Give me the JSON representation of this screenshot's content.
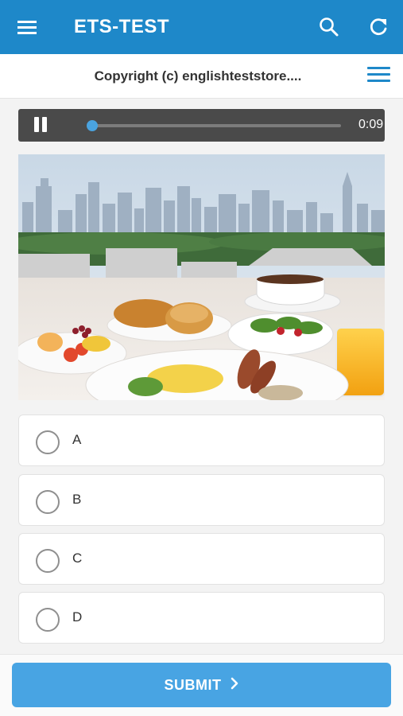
{
  "appbar": {
    "title": "ETS-TEST",
    "menu_icon": "hamburger-menu-icon",
    "search_icon": "search-icon",
    "refresh_icon": "refresh-icon",
    "color": "#1e88c9"
  },
  "subbar": {
    "copyright": "Copyright (c) englishteststore....",
    "list_icon": "list-menu-icon",
    "accent": "#1e88c9"
  },
  "player": {
    "state_icon": "pause-icon",
    "progress": 0.0,
    "time": "0:09"
  },
  "photo": {
    "subject": "breakfast-table-city-skyline-image"
  },
  "options": [
    {
      "label": "A",
      "selected": false
    },
    {
      "label": "B",
      "selected": false
    },
    {
      "label": "C",
      "selected": false
    },
    {
      "label": "D",
      "selected": false
    }
  ],
  "submit": {
    "label": "SUBMIT",
    "icon": "chevron-right-icon",
    "color": "#48a4e3"
  }
}
